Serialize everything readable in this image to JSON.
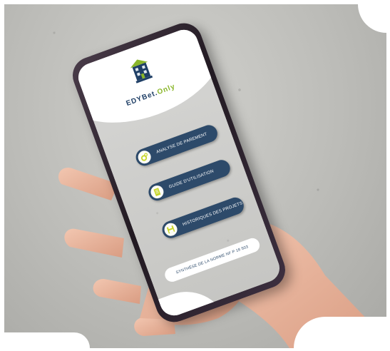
{
  "app": {
    "brand_main": "EDYBet.",
    "brand_accent": "Only",
    "logo_icon": "building-logo-icon"
  },
  "menu": {
    "items": [
      {
        "label": "ANALYSE DE PAREMENT",
        "icon": "gears-icon"
      },
      {
        "label": "GUIDE D'UTILISATION",
        "icon": "document-icon"
      },
      {
        "label": "HISTORIQUES DES PROJETS",
        "icon": "floppy-disk-icon"
      }
    ],
    "footer_link": "SYNTHÈSE DE LA NORME NF P 18 503"
  },
  "colors": {
    "brand_navy": "#1f3f66",
    "button_navy": "#2d4a6a",
    "accent_green": "#8ab62a",
    "icon_yellow": "#c8d62a"
  }
}
